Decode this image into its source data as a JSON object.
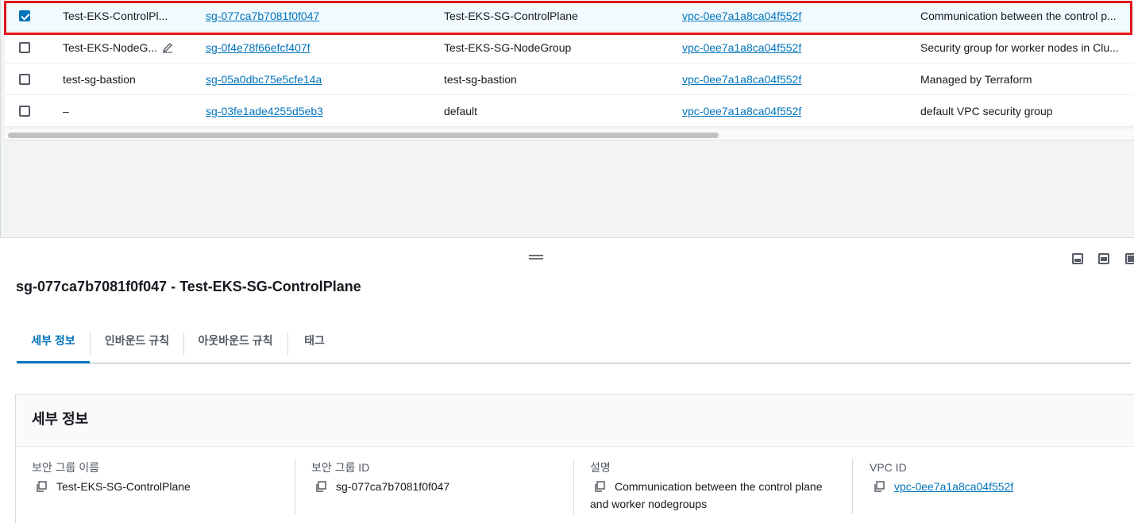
{
  "table": {
    "rows": [
      {
        "selected": true,
        "name": "Test-EKS-ControlPl...",
        "sg_id": "sg-077ca7b7081f0f047",
        "sg_name": "Test-EKS-SG-ControlPlane",
        "vpc_id": "vpc-0ee7a1a8ca04f552f",
        "description": "Communication between the control p..."
      },
      {
        "selected": false,
        "name": "Test-EKS-NodeG...",
        "sg_id": "sg-0f4e78f66efcf407f",
        "sg_name": "Test-EKS-SG-NodeGroup",
        "vpc_id": "vpc-0ee7a1a8ca04f552f",
        "description": "Security group for worker nodes in Clu..."
      },
      {
        "selected": false,
        "name": "test-sg-bastion",
        "sg_id": "sg-05a0dbc75e5cfe14a",
        "sg_name": "test-sg-bastion",
        "vpc_id": "vpc-0ee7a1a8ca04f552f",
        "description": "Managed by Terraform"
      },
      {
        "selected": false,
        "name": "–",
        "sg_id": "sg-03fe1ade4255d5eb3",
        "sg_name": "default",
        "vpc_id": "vpc-0ee7a1a8ca04f552f",
        "description": "default VPC security group"
      }
    ],
    "edit_icon": "pencil-icon"
  },
  "details_panel": {
    "title": "sg-077ca7b7081f0f047 - Test-EKS-SG-ControlPlane",
    "tabs": [
      {
        "label": "세부 정보",
        "active": true
      },
      {
        "label": "인바운드 규칙",
        "active": false
      },
      {
        "label": "아웃바운드 규칙",
        "active": false
      },
      {
        "label": "태그",
        "active": false
      }
    ],
    "section_title": "세부 정보",
    "fields": {
      "sg_name": {
        "label": "보안 그룹 이름",
        "value": "Test-EKS-SG-ControlPlane"
      },
      "sg_id": {
        "label": "보안 그룹 ID",
        "value": "sg-077ca7b7081f0f047"
      },
      "description": {
        "label": "설명",
        "value_line1": "Communication between the control plane",
        "value_line2": "and worker nodegroups"
      },
      "vpc_id": {
        "label": "VPC ID",
        "value": "vpc-0ee7a1a8ca04f552f"
      }
    }
  },
  "colors": {
    "link": "#0073bb",
    "selected_row": "#f1faff",
    "highlight_border": "#e3161b"
  }
}
